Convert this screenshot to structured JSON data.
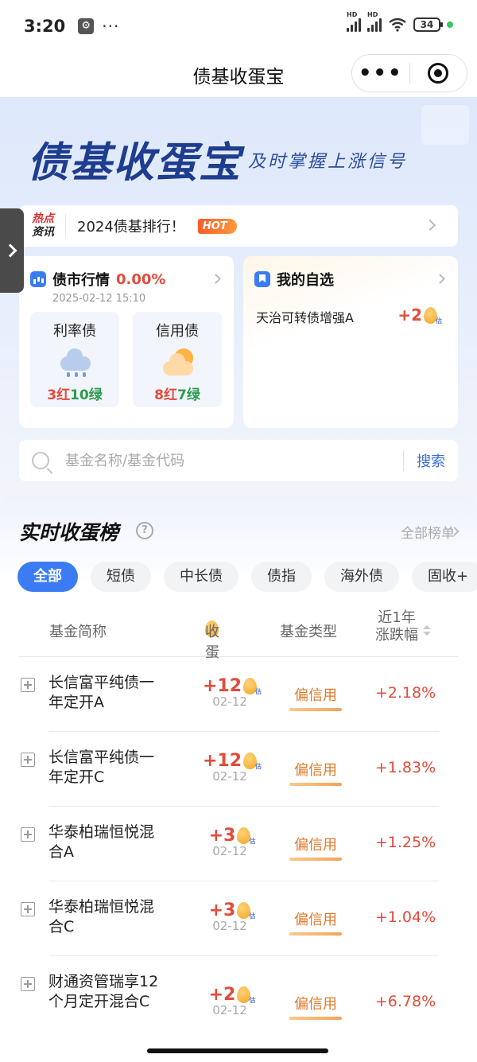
{
  "status_bar": {
    "time": "3:20",
    "dots": "···",
    "battery": "34",
    "hd": "HD"
  },
  "nav": {
    "title": "债基收蛋宝",
    "more": "•••"
  },
  "banner": {
    "title": "债基收蛋宝",
    "slogan": "及时掌握上涨信号"
  },
  "hot_news": {
    "tag_line1": "热点",
    "tag_line2": "资讯",
    "text": "2024债基排行！",
    "badge": "HOT"
  },
  "market": {
    "title": "债市行情",
    "pct": "0.00%",
    "date": "2025-02-12 15:10",
    "cards": [
      {
        "title": "利率债",
        "red": "3红",
        "green": "10绿",
        "weather": "rainy-icon"
      },
      {
        "title": "信用债",
        "red": "8红",
        "green": "7绿",
        "weather": "partly-sunny-icon"
      }
    ]
  },
  "favorites": {
    "title": "我的自选",
    "item": "天治可转债增强A",
    "value": "+2",
    "est": "估"
  },
  "search": {
    "placeholder": "基金名称/基金代码",
    "button": "搜索"
  },
  "ranking": {
    "title": "实时收蛋榜",
    "help": "?",
    "all": "全部榜单",
    "tabs": [
      "全部",
      "短债",
      "中长债",
      "债指",
      "海外债",
      "固收+"
    ],
    "headers": {
      "name": "基金简称",
      "egg": "收蛋",
      "type": "基金类型",
      "change_line1": "近1年",
      "change_line2": "涨跌幅"
    },
    "rows": [
      {
        "name": "长信富平纯债一年定开A",
        "egg": "+12",
        "date": "02-12",
        "type": "偏信用",
        "change": "+2.18%"
      },
      {
        "name": "长信富平纯债一年定开C",
        "egg": "+12",
        "date": "02-12",
        "type": "偏信用",
        "change": "+1.83%"
      },
      {
        "name": "华泰柏瑞恒悦混合A",
        "egg": "+3",
        "date": "02-12",
        "type": "偏信用",
        "change": "+1.25%"
      },
      {
        "name": "华泰柏瑞恒悦混合C",
        "egg": "+3",
        "date": "02-12",
        "type": "偏信用",
        "change": "+1.04%"
      },
      {
        "name": "财通资管瑞享12个月定开混合C",
        "egg": "+2",
        "date": "02-12",
        "type": "偏信用",
        "change": "+6.78%"
      }
    ],
    "est": "估"
  },
  "colors": {
    "accent": "#3b7cf5",
    "up": "#e24b3b",
    "down": "#2a9d4b",
    "type": "#e07a2b",
    "brand": "#1f3d8f"
  }
}
